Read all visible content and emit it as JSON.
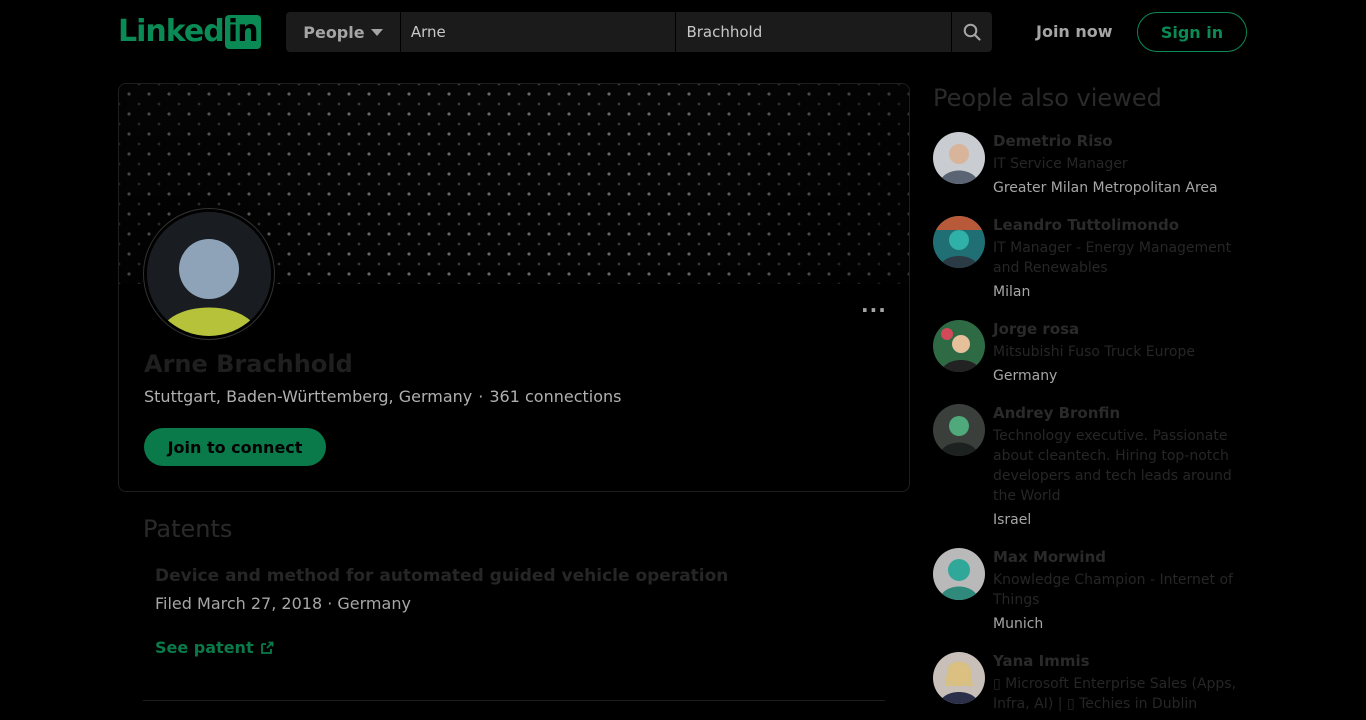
{
  "header": {
    "logo_text": "Linked",
    "logo_box": "in",
    "filter_label": "People",
    "first_name_value": "Arne",
    "last_name_value": "Brachhold",
    "join_label": "Join now",
    "signin_label": "Sign in"
  },
  "profile": {
    "name": "Arne Brachhold",
    "location": "Stuttgart, Baden-Württemberg, Germany",
    "separator": "·",
    "connections": "361 connections",
    "connect_label": "Join to connect",
    "more_label": "···"
  },
  "patents": {
    "heading": "Patents",
    "items": [
      {
        "title": "Device and method for automated guided vehicle operation",
        "meta": "Filed March 27, 2018 · Germany",
        "link_label": "See patent"
      }
    ]
  },
  "sidebar": {
    "heading": "People also viewed",
    "people": [
      {
        "name": "Demetrio Riso",
        "title": "IT Service Manager",
        "location": "Greater Milan Metropolitan Area"
      },
      {
        "name": "Leandro Tuttolimondo",
        "title": "IT Manager - Energy Management and Renewables",
        "location": "Milan"
      },
      {
        "name": "Jorge rosa",
        "title": "Mitsubishi Fuso Truck Europe",
        "location": "Germany"
      },
      {
        "name": "Andrey Bronfin",
        "title": "Technology executive. Passionate about cleantech. Hiring top-notch developers and tech leads around the World",
        "location": "Israel"
      },
      {
        "name": "Max Morwind",
        "title": "Knowledge Champion - Internet of Things",
        "location": "Munich"
      },
      {
        "name": "Yana Immis",
        "title": "▯ Microsoft Enterprise Sales (Apps, Infra, AI) | ▯ Techies in Dublin",
        "location": ""
      }
    ]
  },
  "colors": {
    "brand": "#0a8a55",
    "background": "#000000"
  }
}
